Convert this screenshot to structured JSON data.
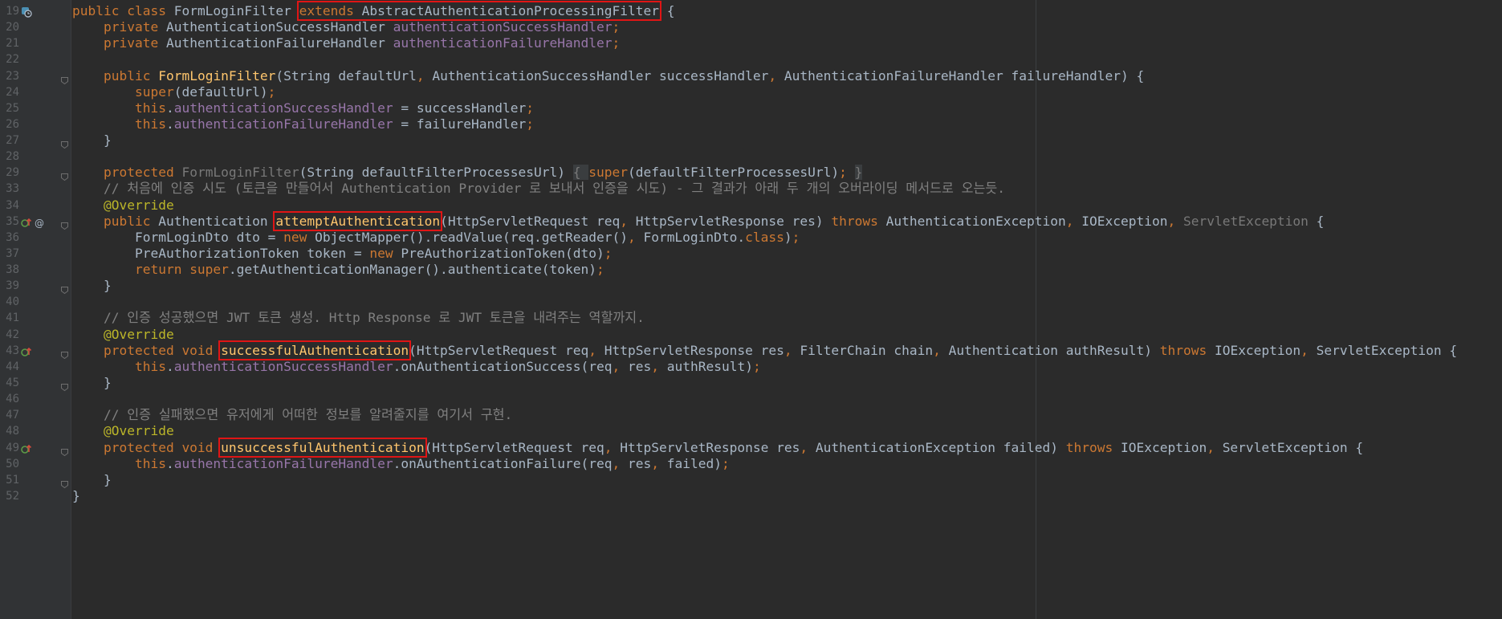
{
  "editor": {
    "language": "Java",
    "theme": "Darcula",
    "highlight_color": "#e01515",
    "highlighted_tokens": [
      "extends AbstractAuthenticationProcessingFilter",
      "attemptAuthentication",
      "successfulAuthentication",
      "unsuccessfulAuthentication"
    ]
  },
  "lines": [
    {
      "num": "19",
      "indent": "",
      "tokens": [
        {
          "t": "public class ",
          "c": "kw"
        },
        {
          "t": "FormLoginFilter "
        },
        {
          "t": "extends ",
          "c": "kw",
          "hl": true,
          "grp": "a"
        },
        {
          "t": "AbstractAuthenticationProcessingFilter",
          "hl": true,
          "grp": "a"
        },
        {
          "t": " {"
        }
      ]
    },
    {
      "num": "20",
      "indent": "    ",
      "tokens": [
        {
          "t": "private ",
          "c": "kw"
        },
        {
          "t": "AuthenticationSuccessHandler "
        },
        {
          "t": "authenticationSuccessHandler",
          "c": "fld"
        },
        {
          "t": ";",
          "c": "kw"
        }
      ]
    },
    {
      "num": "21",
      "indent": "    ",
      "tokens": [
        {
          "t": "private ",
          "c": "kw"
        },
        {
          "t": "AuthenticationFailureHandler "
        },
        {
          "t": "authenticationFailureHandler",
          "c": "fld"
        },
        {
          "t": ";",
          "c": "kw"
        }
      ]
    },
    {
      "num": "22",
      "indent": "",
      "tokens": []
    },
    {
      "num": "23",
      "indent": "    ",
      "tokens": [
        {
          "t": "public ",
          "c": "kw"
        },
        {
          "t": "FormLoginFilter",
          "c": "fn"
        },
        {
          "t": "(String defaultUrl"
        },
        {
          "t": ", ",
          "c": "kw"
        },
        {
          "t": "AuthenticationSuccessHandler successHandler"
        },
        {
          "t": ", ",
          "c": "kw"
        },
        {
          "t": "AuthenticationFailureHandler failureHandler) {"
        }
      ]
    },
    {
      "num": "24",
      "indent": "        ",
      "tokens": [
        {
          "t": "super",
          "c": "kw"
        },
        {
          "t": "(defaultUrl)"
        },
        {
          "t": ";",
          "c": "kw"
        }
      ]
    },
    {
      "num": "25",
      "indent": "        ",
      "tokens": [
        {
          "t": "this",
          "c": "kw"
        },
        {
          "t": "."
        },
        {
          "t": "authenticationSuccessHandler",
          "c": "fld"
        },
        {
          "t": " = successHandler"
        },
        {
          "t": ";",
          "c": "kw"
        }
      ]
    },
    {
      "num": "26",
      "indent": "        ",
      "tokens": [
        {
          "t": "this",
          "c": "kw"
        },
        {
          "t": "."
        },
        {
          "t": "authenticationFailureHandler",
          "c": "fld"
        },
        {
          "t": " = failureHandler"
        },
        {
          "t": ";",
          "c": "kw"
        }
      ]
    },
    {
      "num": "27",
      "indent": "    ",
      "tokens": [
        {
          "t": "}"
        }
      ]
    },
    {
      "num": "28",
      "indent": "",
      "tokens": []
    },
    {
      "num": "29",
      "indent": "    ",
      "tokens": [
        {
          "t": "protected ",
          "c": "kw"
        },
        {
          "t": "FormLoginFilter",
          "c": "dim"
        },
        {
          "t": "(String defaultFilterProcessesUrl) "
        },
        {
          "t": "{ ",
          "c": "dim",
          "bg": true
        },
        {
          "t": "super",
          "c": "kw"
        },
        {
          "t": "(defaultFilterProcessesUrl)"
        },
        {
          "t": "; ",
          "c": "kw"
        },
        {
          "t": "}",
          "c": "dim",
          "bg": true
        }
      ]
    },
    {
      "num": "33",
      "indent": "    ",
      "tokens": [
        {
          "t": "// 처음에 인증 시도 (토큰을 만들어서 Authentication Provider 로 보내서 인증을 시도) - 그 결과가 아래 두 개의 오버라이딩 메서드로 오는듯.",
          "c": "cmt"
        }
      ]
    },
    {
      "num": "34",
      "indent": "    ",
      "tokens": [
        {
          "t": "@Override",
          "c": "ann"
        }
      ]
    },
    {
      "num": "35",
      "indent": "    ",
      "tokens": [
        {
          "t": "public ",
          "c": "kw"
        },
        {
          "t": "Authentication "
        },
        {
          "t": "attemptAuthentication",
          "c": "fn",
          "hl": true
        },
        {
          "t": "(HttpServletRequest req"
        },
        {
          "t": ", ",
          "c": "kw"
        },
        {
          "t": "HttpServletResponse res) "
        },
        {
          "t": "throws ",
          "c": "kw"
        },
        {
          "t": "AuthenticationException"
        },
        {
          "t": ", ",
          "c": "kw"
        },
        {
          "t": "IOException"
        },
        {
          "t": ", ",
          "c": "kw"
        },
        {
          "t": "ServletException",
          "c": "dim"
        },
        {
          "t": " {"
        }
      ]
    },
    {
      "num": "36",
      "indent": "        ",
      "tokens": [
        {
          "t": "FormLoginDto dto = "
        },
        {
          "t": "new ",
          "c": "kw"
        },
        {
          "t": "ObjectMapper().readValue(req.getReader()"
        },
        {
          "t": ", ",
          "c": "kw"
        },
        {
          "t": "FormLoginDto."
        },
        {
          "t": "class",
          "c": "kw"
        },
        {
          "t": ")"
        },
        {
          "t": ";",
          "c": "kw"
        }
      ]
    },
    {
      "num": "37",
      "indent": "        ",
      "tokens": [
        {
          "t": "PreAuthorizationToken token = "
        },
        {
          "t": "new ",
          "c": "kw"
        },
        {
          "t": "PreAuthorizationToken(dto)"
        },
        {
          "t": ";",
          "c": "kw"
        }
      ]
    },
    {
      "num": "38",
      "indent": "        ",
      "tokens": [
        {
          "t": "return super",
          "c": "kw"
        },
        {
          "t": ".getAuthenticationManager().authenticate(token)"
        },
        {
          "t": ";",
          "c": "kw"
        }
      ]
    },
    {
      "num": "39",
      "indent": "    ",
      "tokens": [
        {
          "t": "}"
        }
      ]
    },
    {
      "num": "40",
      "indent": "",
      "tokens": []
    },
    {
      "num": "41",
      "indent": "    ",
      "tokens": [
        {
          "t": "// 인증 성공했으면 JWT 토큰 생성. Http Response 로 JWT 토큰을 내려주는 역할까지.",
          "c": "cmt"
        }
      ]
    },
    {
      "num": "42",
      "indent": "    ",
      "tokens": [
        {
          "t": "@Override",
          "c": "ann"
        }
      ]
    },
    {
      "num": "43",
      "indent": "    ",
      "tokens": [
        {
          "t": "protected void ",
          "c": "kw"
        },
        {
          "t": "successfulAuthentication",
          "c": "fn",
          "hl": true
        },
        {
          "t": "(HttpServletRequest req"
        },
        {
          "t": ", ",
          "c": "kw"
        },
        {
          "t": "HttpServletResponse res"
        },
        {
          "t": ", ",
          "c": "kw"
        },
        {
          "t": "FilterChain chain"
        },
        {
          "t": ", ",
          "c": "kw"
        },
        {
          "t": "Authentication authResult) "
        },
        {
          "t": "throws ",
          "c": "kw"
        },
        {
          "t": "IOException"
        },
        {
          "t": ", ",
          "c": "kw"
        },
        {
          "t": "ServletException {"
        }
      ]
    },
    {
      "num": "44",
      "indent": "        ",
      "tokens": [
        {
          "t": "this",
          "c": "kw"
        },
        {
          "t": "."
        },
        {
          "t": "authenticationSuccessHandler",
          "c": "fld"
        },
        {
          "t": ".onAuthenticationSuccess(req"
        },
        {
          "t": ", ",
          "c": "kw"
        },
        {
          "t": "res"
        },
        {
          "t": ", ",
          "c": "kw"
        },
        {
          "t": "authResult)"
        },
        {
          "t": ";",
          "c": "kw"
        }
      ]
    },
    {
      "num": "45",
      "indent": "    ",
      "tokens": [
        {
          "t": "}"
        }
      ]
    },
    {
      "num": "46",
      "indent": "",
      "tokens": []
    },
    {
      "num": "47",
      "indent": "    ",
      "tokens": [
        {
          "t": "// 인증 실패했으면 유저에게 어떠한 정보를 알려줄지를 여기서 구현.",
          "c": "cmt"
        }
      ]
    },
    {
      "num": "48",
      "indent": "    ",
      "tokens": [
        {
          "t": "@Override",
          "c": "ann"
        }
      ]
    },
    {
      "num": "49",
      "indent": "    ",
      "tokens": [
        {
          "t": "protected void ",
          "c": "kw"
        },
        {
          "t": "unsuccessfulAuthentication",
          "c": "fn",
          "hl": true
        },
        {
          "t": "(HttpServletRequest req"
        },
        {
          "t": ", ",
          "c": "kw"
        },
        {
          "t": "HttpServletResponse res"
        },
        {
          "t": ", ",
          "c": "kw"
        },
        {
          "t": "AuthenticationException failed) "
        },
        {
          "t": "throws ",
          "c": "kw"
        },
        {
          "t": "IOException"
        },
        {
          "t": ", ",
          "c": "kw"
        },
        {
          "t": "ServletException {"
        }
      ]
    },
    {
      "num": "50",
      "indent": "        ",
      "tokens": [
        {
          "t": "this",
          "c": "kw"
        },
        {
          "t": "."
        },
        {
          "t": "authenticationFailureHandler",
          "c": "fld"
        },
        {
          "t": ".onAuthenticationFailure(req"
        },
        {
          "t": ", ",
          "c": "kw"
        },
        {
          "t": "res"
        },
        {
          "t": ", ",
          "c": "kw"
        },
        {
          "t": "failed)"
        },
        {
          "t": ";",
          "c": "kw"
        }
      ]
    },
    {
      "num": "51",
      "indent": "    ",
      "tokens": [
        {
          "t": "}"
        }
      ]
    },
    {
      "num": "52",
      "indent": "",
      "tokens": [
        {
          "t": "}"
        }
      ]
    }
  ],
  "gutter_markers": {
    "19": [
      "class-hierarchy-icon"
    ],
    "35": [
      "override-icon",
      "annotation-at-icon"
    ],
    "43": [
      "override-icon"
    ],
    "49": [
      "override-icon"
    ]
  },
  "fold_markers": [
    "23",
    "27",
    "29",
    "35",
    "39",
    "43",
    "45",
    "49",
    "51"
  ]
}
